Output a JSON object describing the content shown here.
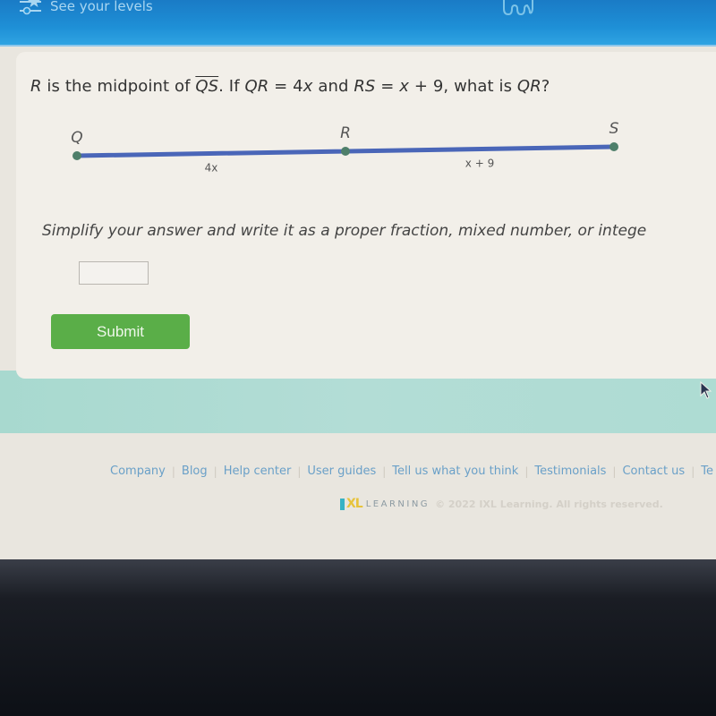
{
  "header": {
    "levels_label": "See your levels",
    "levels_icon": "levels-star-icon",
    "right_icon": "character-icon"
  },
  "question": {
    "prefix": "R",
    "text1": " is the midpoint of ",
    "segment": "QS",
    "text2": ". If ",
    "qr": "QR",
    "eq1": " = 4",
    "x1": "x",
    "text3": " and ",
    "rs": "RS",
    "eq2": " = ",
    "x2": "x",
    "eq2b": " + 9, what is ",
    "qr2": "QR",
    "end": "?"
  },
  "diagram": {
    "points": [
      {
        "label": "Q",
        "position": 0.0
      },
      {
        "label": "R",
        "position": 0.5
      },
      {
        "label": "S",
        "position": 1.0
      }
    ],
    "segments": [
      {
        "label": "4x",
        "from": 0.0,
        "to": 0.5
      },
      {
        "label": "x + 9",
        "from": 0.5,
        "to": 1.0
      }
    ],
    "line_color": "#4a66b8",
    "point_color": "#4e7f6a"
  },
  "instructions": "Simplify your answer and write it as a proper fraction, mixed number, or intege",
  "answer": {
    "value": "",
    "placeholder": ""
  },
  "submit_label": "Submit",
  "footer": {
    "links": [
      "Company",
      "Blog",
      "Help center",
      "User guides",
      "Tell us what you think",
      "Testimonials",
      "Contact us",
      "Te"
    ],
    "logo_xl": "XL",
    "logo_learning": "LEARNING",
    "copyright": "© 2022 IXL Learning. All rights reserved."
  },
  "colors": {
    "header_blue": "#1e8fd6",
    "submit_green": "#5aae48",
    "link_blue": "#6aa0c8",
    "band_teal": "#b3ddd6"
  }
}
